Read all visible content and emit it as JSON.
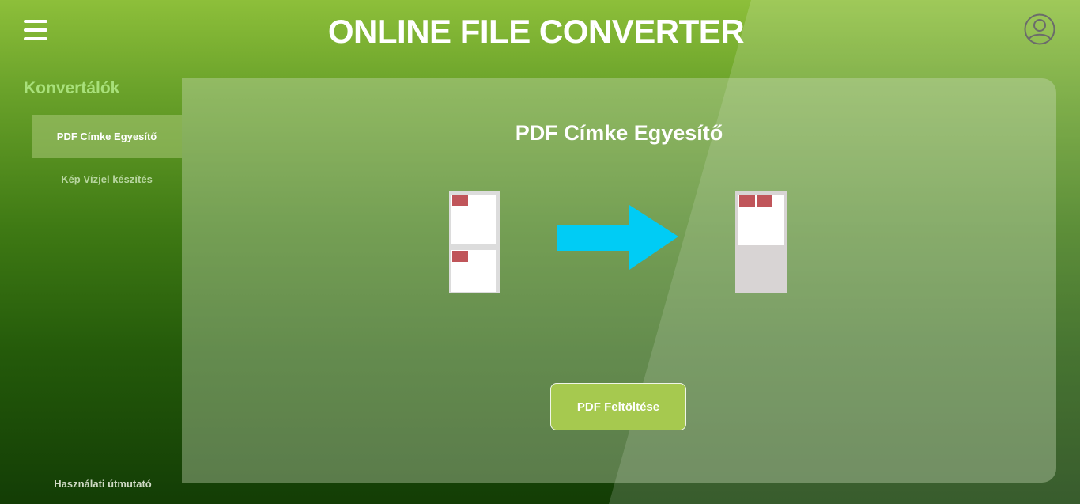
{
  "header": {
    "title": "ONLINE FILE CONVERTER",
    "menu_icon": "hamburger-menu-icon",
    "profile_icon": "user-profile-icon"
  },
  "sidebar": {
    "heading": "Konvertálók",
    "items": [
      {
        "label": "PDF Címke Egyesítő",
        "active": true
      },
      {
        "label": "Kép Vízjel készítés",
        "active": false
      }
    ],
    "help_link": "Használati útmutató"
  },
  "main": {
    "title": "PDF Címke Egyesítő",
    "upload_button": "PDF Feltöltése",
    "illustration": {
      "source_icon": "two-label-pages-icon",
      "arrow_icon": "right-arrow-icon",
      "result_icon": "merged-labels-page-icon"
    }
  },
  "colors": {
    "accent_button": "#a6c94f",
    "label_red": "#c0555a",
    "arrow_cyan": "#00ccf5",
    "heading_green": "#a8e07a"
  }
}
